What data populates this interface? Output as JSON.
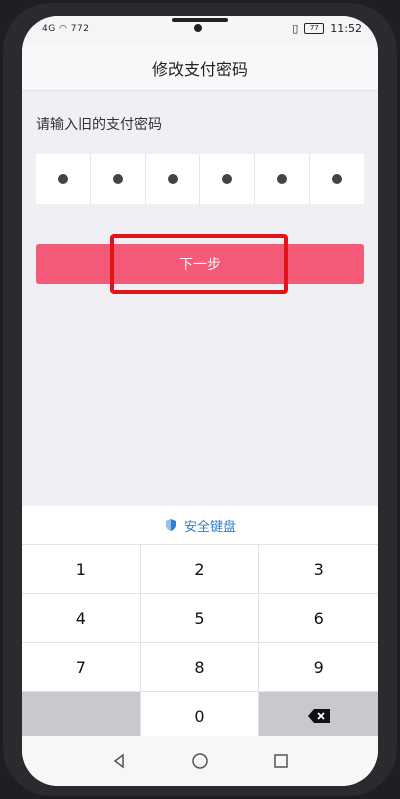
{
  "status_bar": {
    "signal_text": "4G",
    "speed_text": "772",
    "battery": "77",
    "time": "11:52"
  },
  "title": "修改支付密码",
  "prompt": "请输入旧的支付密码",
  "pin": {
    "filled_count": 6,
    "length": 6
  },
  "next_button": "下一步",
  "keyboard": {
    "header": "安全键盘",
    "keys": [
      "1",
      "2",
      "3",
      "4",
      "5",
      "6",
      "7",
      "8",
      "9",
      "",
      "0",
      "⌫"
    ]
  },
  "icons": {
    "shield": "shield-icon",
    "backspace": "backspace-icon",
    "back": "nav-back-icon",
    "home": "nav-home-icon",
    "recents": "nav-recents-icon"
  },
  "colors": {
    "accent": "#f45a78",
    "highlight": "#e1141a",
    "kb_header": "#2f7fd3"
  }
}
